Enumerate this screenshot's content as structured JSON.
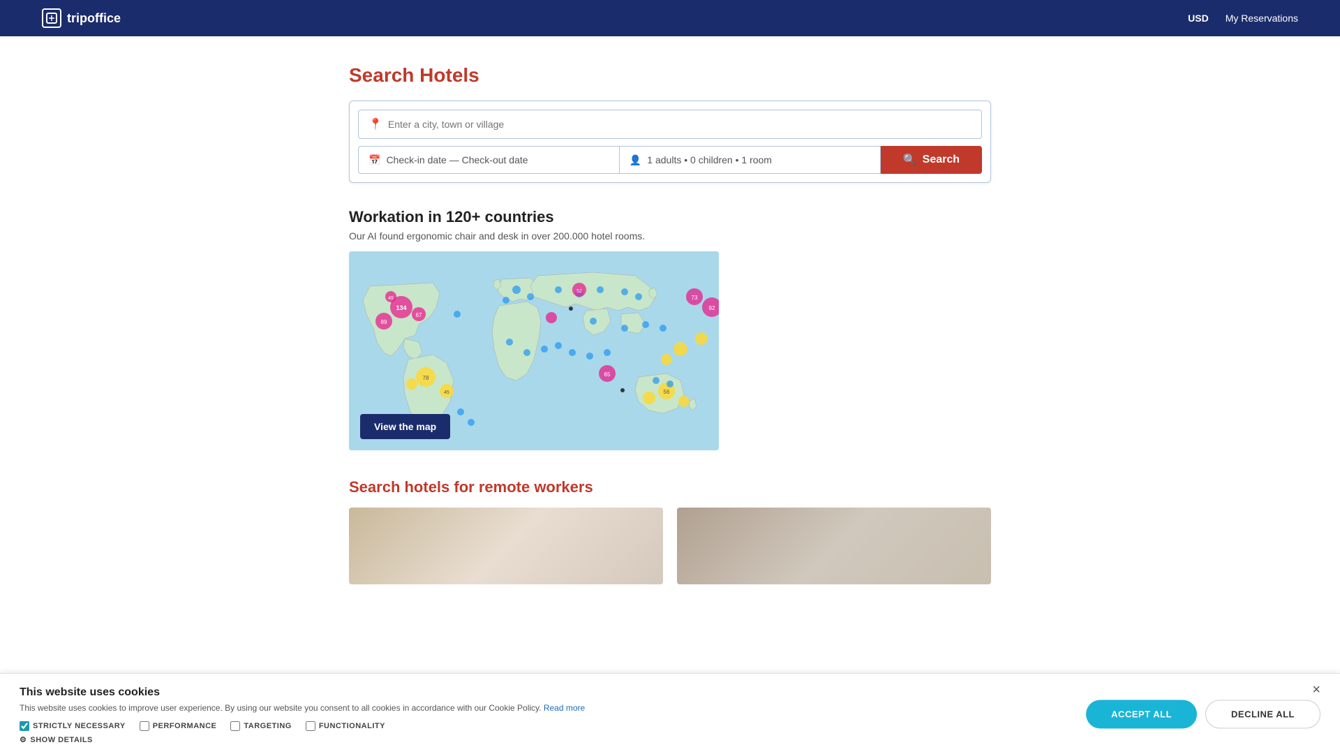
{
  "navbar": {
    "brand": "tripoffice",
    "currency": "USD",
    "reservations": "My Reservations"
  },
  "search": {
    "title_prefix": "Search ",
    "title_highlight": "Hotels",
    "location_placeholder": "Enter a city, town or village",
    "dates_placeholder": "Check-in date — Check-out date",
    "guests_value": "1 adults • 0 children • 1 room",
    "button_label": "Search"
  },
  "workation": {
    "title": "Workation in 120+ countries",
    "description": "Our AI found ergonomic chair and desk in over 200.000 hotel rooms.",
    "view_map_label": "View the map"
  },
  "remote": {
    "title_prefix": "Search hotels for ",
    "title_highlight": "remote workers"
  },
  "cookie": {
    "title": "This website uses cookies",
    "description": "This website uses cookies to improve user experience. By using our website you consent to all cookies in accordance with our Cookie Policy.",
    "read_more": "Read more",
    "checkboxes": [
      {
        "label": "STRICTLY NECESSARY",
        "checked": true
      },
      {
        "label": "PERFORMANCE",
        "checked": false
      },
      {
        "label": "TARGETING",
        "checked": false
      },
      {
        "label": "FUNCTIONALITY",
        "checked": false
      }
    ],
    "show_details": "SHOW DETAILS",
    "accept_all": "ACCEPT ALL",
    "decline_all": "DECLINE ALL"
  }
}
